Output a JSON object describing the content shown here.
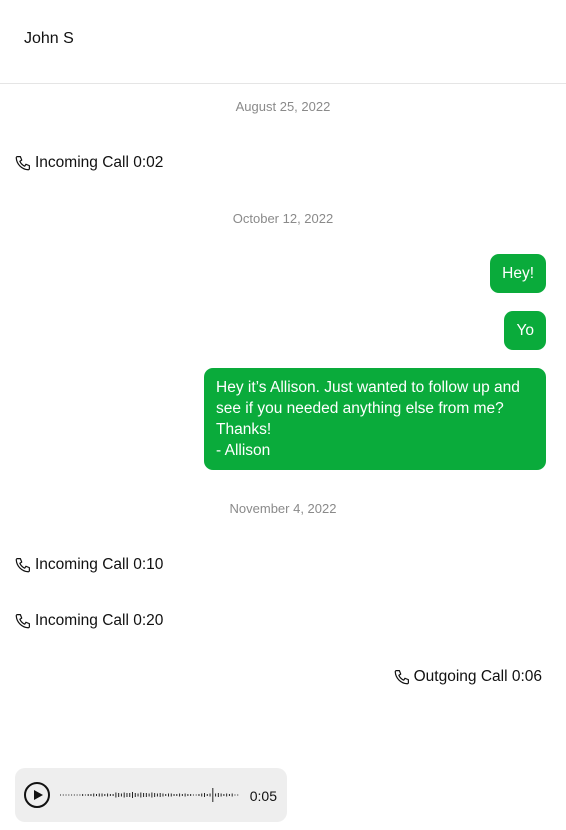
{
  "header": {
    "contact_name": "John S"
  },
  "conversation": {
    "dates": [
      "August 25, 2022",
      "October 12, 2022",
      "November 4, 2022"
    ],
    "calls": [
      {
        "direction": "incoming",
        "text": "Incoming Call 0:02",
        "icon": "phone-icon"
      },
      {
        "direction": "incoming",
        "text": "Incoming Call 0:10",
        "icon": "phone-icon"
      },
      {
        "direction": "incoming",
        "text": "Incoming Call 0:20",
        "icon": "phone-icon"
      },
      {
        "direction": "outgoing",
        "text": "Outgoing Call 0:06",
        "icon": "phone-icon"
      }
    ],
    "messages": [
      {
        "direction": "sent",
        "lines": [
          "Hey!"
        ]
      },
      {
        "direction": "sent",
        "lines": [
          "Yo"
        ]
      },
      {
        "direction": "sent",
        "lines": [
          "Hey it’s Allison. Just wanted to follow up and",
          "see if you needed anything else from me?",
          "Thanks!",
          "- Allison"
        ]
      }
    ]
  },
  "audio_player": {
    "duration": "0:05",
    "progress": 0,
    "play_icon": "play-icon"
  },
  "colors": {
    "sent_bubble": "#0aab3b",
    "date_text": "#8a8a8a",
    "player_background": "#eeeeee"
  }
}
